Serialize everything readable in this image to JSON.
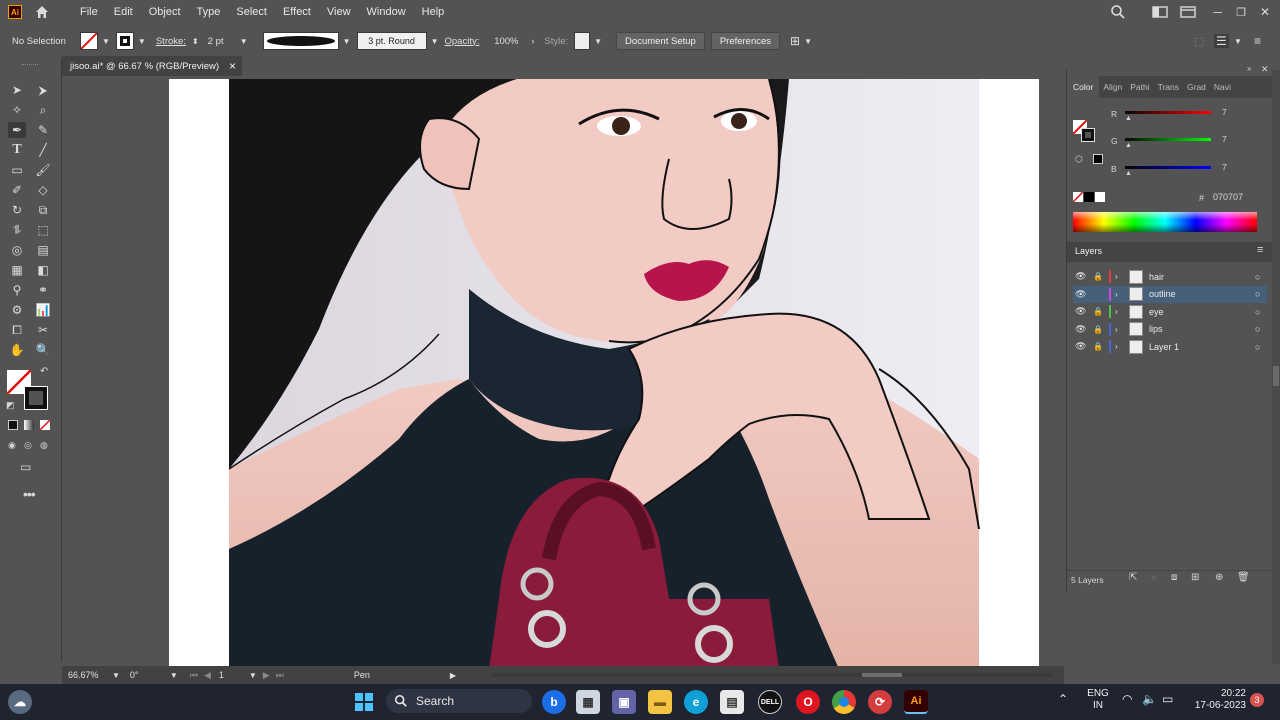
{
  "app": {
    "logo": "Ai"
  },
  "menu": [
    "File",
    "Edit",
    "Object",
    "Type",
    "Select",
    "Effect",
    "View",
    "Window",
    "Help"
  ],
  "control": {
    "selection": "No Selection",
    "stroke_label": "Stroke:",
    "stroke_value": "2 pt",
    "brush": "3 pt. Round",
    "opacity_label": "Opacity:",
    "opacity_value": "100%",
    "style_label": "Style:",
    "document_setup": "Document Setup",
    "preferences": "Preferences"
  },
  "doc_tab": {
    "title": "jisoo.ai* @ 66.67 % (RGB/Preview)",
    "close": "×"
  },
  "status": {
    "zoom": "66.67%",
    "rotate": "0°",
    "artboard": "1",
    "tool": "Pen"
  },
  "color_panel": {
    "tabs": [
      "Color",
      "Align",
      "Pathi",
      "Trans",
      "Grad",
      "Navi"
    ],
    "r_label": "R",
    "r_value": "7",
    "g_label": "G",
    "g_value": "7",
    "b_label": "B",
    "b_value": "7",
    "hex_label": "#",
    "hex_value": "070707"
  },
  "layers_panel": {
    "title": "Layers",
    "layers": [
      {
        "name": "hair",
        "color": "#e03c3c",
        "selected": false
      },
      {
        "name": "outline",
        "color": "#c84cd6",
        "selected": true
      },
      {
        "name": "eye",
        "color": "#4cc44c",
        "selected": false
      },
      {
        "name": "lips",
        "color": "#4a64d8",
        "selected": false
      },
      {
        "name": "Layer 1",
        "color": "#4a64d8",
        "selected": false
      }
    ],
    "count": "5 Layers"
  },
  "taskbar": {
    "search": "Search",
    "lang1": "ENG",
    "lang2": "IN",
    "time": "20:22",
    "date": "17-06-2023",
    "notif": "3"
  }
}
